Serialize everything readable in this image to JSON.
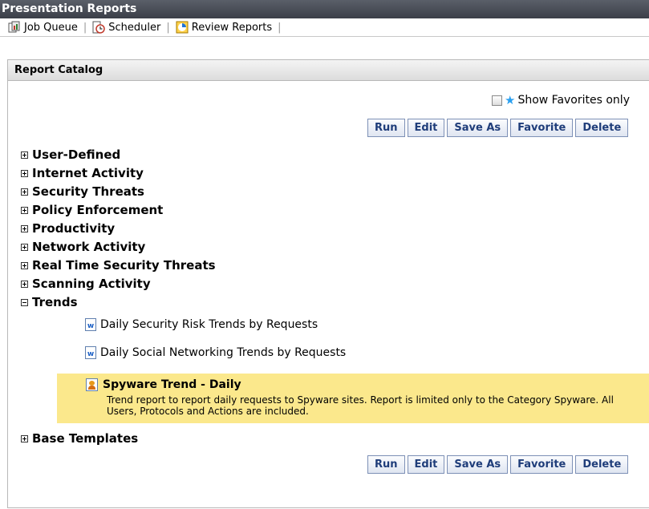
{
  "header": {
    "title": "Presentation Reports"
  },
  "toolbar": {
    "items": [
      {
        "label": "Job Queue",
        "icon": "job-queue-icon"
      },
      {
        "label": "Scheduler",
        "icon": "scheduler-icon"
      },
      {
        "label": "Review Reports",
        "icon": "review-reports-icon"
      }
    ]
  },
  "panel": {
    "title": "Report Catalog",
    "favorites": {
      "label": "Show Favorites only",
      "checked": false
    },
    "buttons": [
      "Run",
      "Edit",
      "Save As",
      "Favorite",
      "Delete"
    ],
    "tree": [
      {
        "label": "User-Defined",
        "expanded": false
      },
      {
        "label": "Internet Activity",
        "expanded": false
      },
      {
        "label": "Security Threats",
        "expanded": false
      },
      {
        "label": "Policy Enforcement",
        "expanded": false
      },
      {
        "label": "Productivity",
        "expanded": false
      },
      {
        "label": "Network Activity",
        "expanded": false
      },
      {
        "label": "Real Time Security Threats",
        "expanded": false
      },
      {
        "label": "Scanning Activity",
        "expanded": false
      },
      {
        "label": "Trends",
        "expanded": true
      },
      {
        "label": "Base Templates",
        "expanded": false
      }
    ],
    "trend_reports": [
      {
        "label": "Daily Security Risk Trends by Requests"
      },
      {
        "label": "Daily Social Networking Trends by Requests"
      }
    ],
    "selected_report": {
      "title": "Spyware Trend - Daily",
      "description": "Trend report to report daily requests to Spyware sites. Report is limited only to the Category Spyware. All Users, Protocols and Actions are included."
    }
  },
  "colors": {
    "header_bg": "#3b3f48",
    "button_text": "#1f3d7a",
    "selected_bg": "#fbe88c",
    "star": "#2aa0f0"
  }
}
